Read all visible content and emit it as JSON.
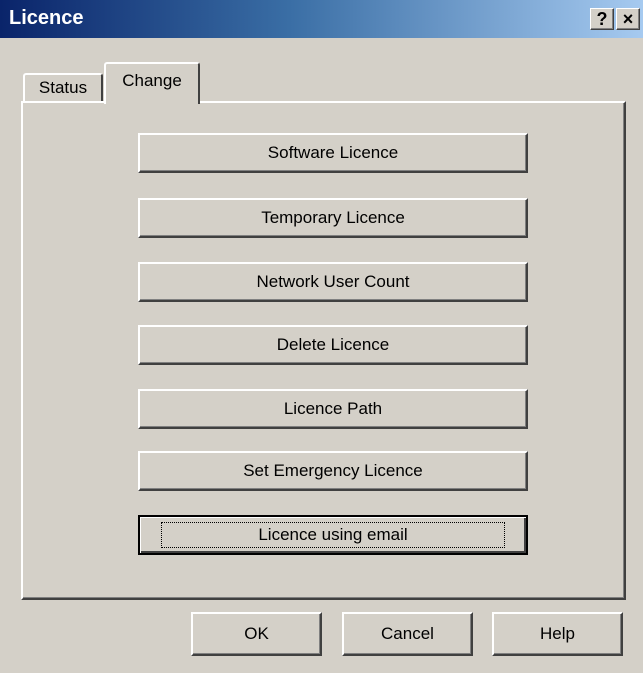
{
  "window": {
    "title": "Licence",
    "help_glyph": "?",
    "close_glyph": "×"
  },
  "tabs": [
    {
      "label": "Status",
      "active": false
    },
    {
      "label": "Change",
      "active": true
    }
  ],
  "actions": [
    {
      "label": "Software Licence"
    },
    {
      "label": "Temporary Licence"
    },
    {
      "label": "Network User Count"
    },
    {
      "label": "Delete Licence"
    },
    {
      "label": "Licence Path"
    },
    {
      "label": "Set Emergency Licence"
    },
    {
      "label": "Licence using email",
      "focused": true
    }
  ],
  "footer": {
    "ok_label": "OK",
    "cancel_label": "Cancel",
    "help_label": "Help"
  },
  "colors": {
    "face": "#d4d0c8",
    "title_start": "#0a246a",
    "title_end": "#a6caf0"
  },
  "icons": {
    "help": "help-question-icon",
    "close": "close-icon"
  }
}
